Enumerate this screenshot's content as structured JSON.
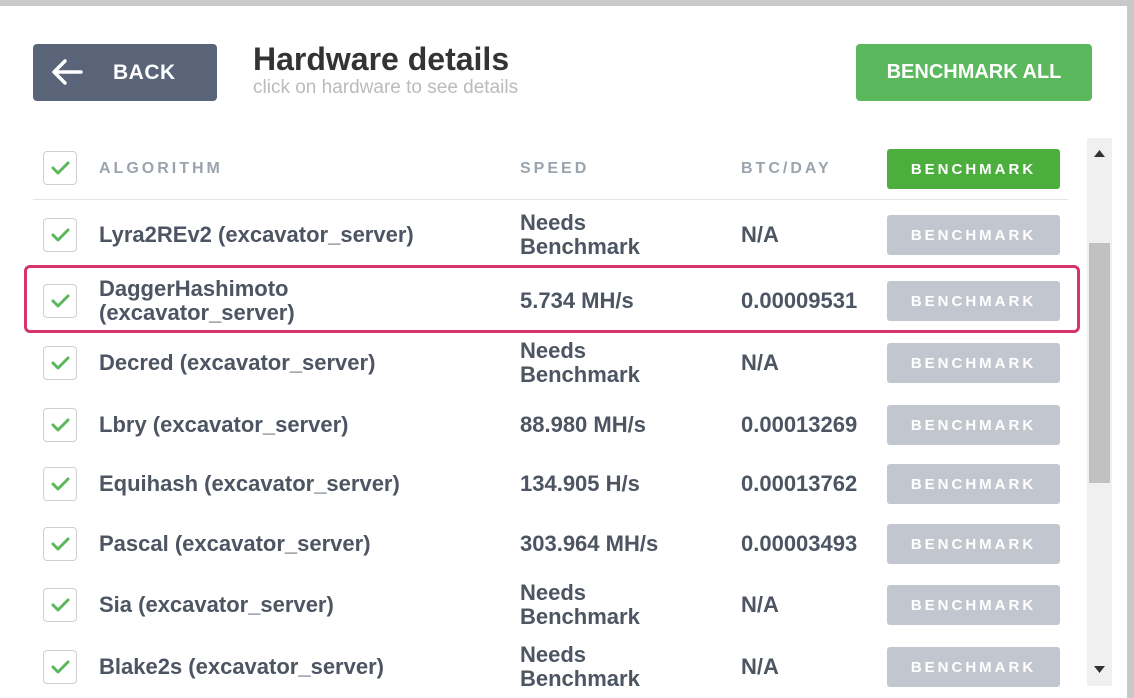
{
  "header": {
    "back_label": "BACK",
    "title": "Hardware details",
    "subtitle": "click on hardware to see details",
    "benchmark_all_label": "BENCHMARK ALL"
  },
  "table": {
    "columns": {
      "algorithm": "ALGORITHM",
      "speed": "SPEED",
      "btc_day": "BTC/DAY",
      "benchmark": "BENCHMARK"
    },
    "header_checked": true,
    "rows": [
      {
        "algo_line1": "Lyra2REv2 (excavator_server)",
        "algo_line2": "",
        "speed_line1": "Needs",
        "speed_line2": "Benchmark",
        "btc": "N/A",
        "button": "BENCHMARK",
        "checked": true
      },
      {
        "algo_line1": "DaggerHashimoto",
        "algo_line2": "(excavator_server)",
        "speed_line1": "5.734 MH/s",
        "speed_line2": "",
        "btc": "0.00009531",
        "button": "BENCHMARK",
        "checked": true,
        "highlighted": true
      },
      {
        "algo_line1": "Decred (excavator_server)",
        "algo_line2": "",
        "speed_line1": "Needs",
        "speed_line2": "Benchmark",
        "btc": "N/A",
        "button": "BENCHMARK",
        "checked": true
      },
      {
        "algo_line1": "Lbry (excavator_server)",
        "algo_line2": "",
        "speed_line1": "88.980 MH/s",
        "speed_line2": "",
        "btc": "0.00013269",
        "button": "BENCHMARK",
        "checked": true
      },
      {
        "algo_line1": "Equihash (excavator_server)",
        "algo_line2": "",
        "speed_line1": "134.905 H/s",
        "speed_line2": "",
        "btc": "0.00013762",
        "button": "BENCHMARK",
        "checked": true
      },
      {
        "algo_line1": "Pascal (excavator_server)",
        "algo_line2": "",
        "speed_line1": "303.964 MH/s",
        "speed_line2": "",
        "btc": "0.00003493",
        "button": "BENCHMARK",
        "checked": true
      },
      {
        "algo_line1": "Sia (excavator_server)",
        "algo_line2": "",
        "speed_line1": "Needs",
        "speed_line2": "Benchmark",
        "btc": "N/A",
        "button": "BENCHMARK",
        "checked": true
      },
      {
        "algo_line1": "Blake2s (excavator_server)",
        "algo_line2": "",
        "speed_line1": "Needs",
        "speed_line2": "Benchmark",
        "btc": "N/A",
        "button": "BENCHMARK",
        "checked": true
      }
    ]
  },
  "colors": {
    "accent_green": "#5cb85c",
    "back_button": "#5a6478",
    "highlight": "#d6356a",
    "disabled_button": "#c2c7cf"
  },
  "icons": {
    "back": "arrow-left-icon",
    "check": "checkmark-icon",
    "scroll_up": "triangle-up-icon",
    "scroll_down": "triangle-down-icon"
  }
}
